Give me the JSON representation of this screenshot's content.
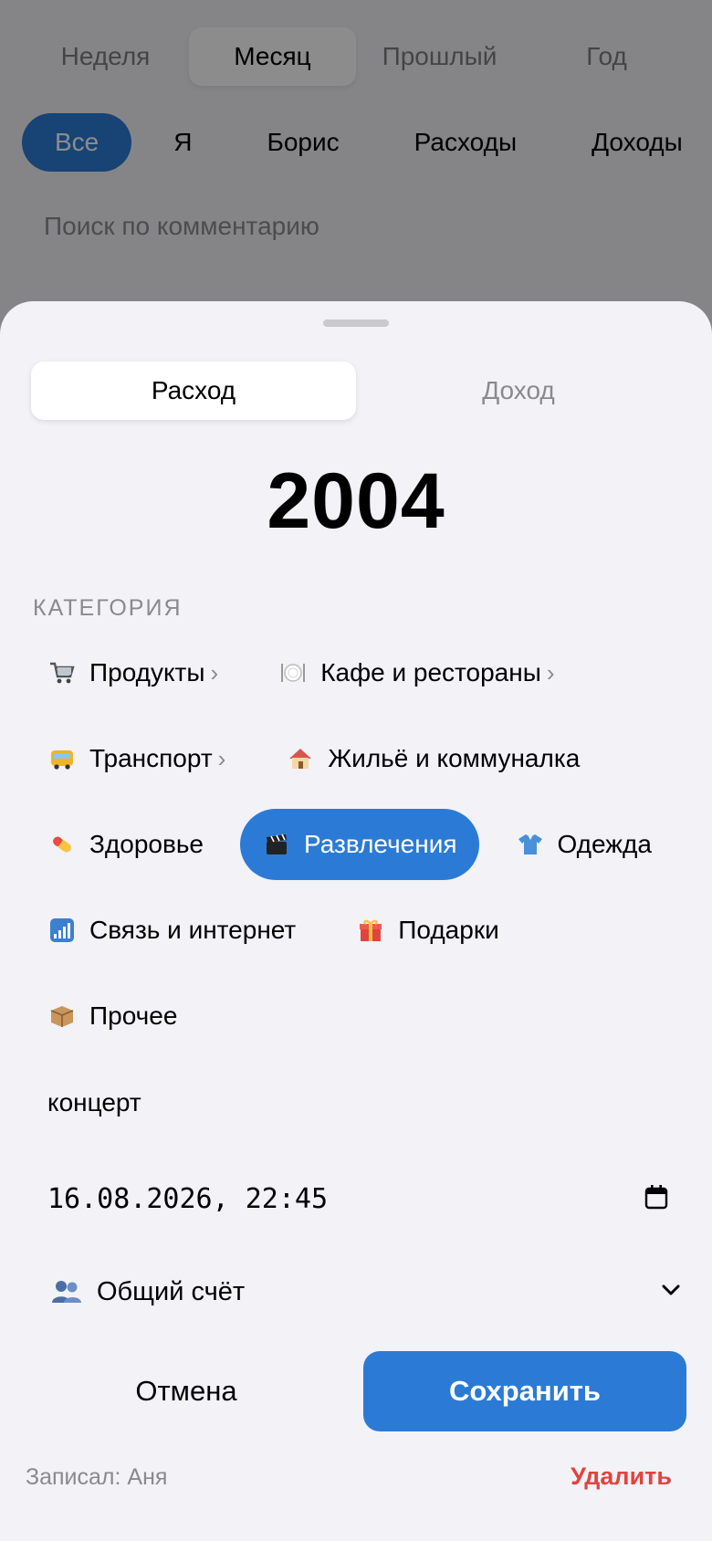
{
  "colors": {
    "accent": "#2b7bd6",
    "danger": "#e0443e",
    "sheet_bg": "#f2f2f7",
    "secondary_text": "#8a8a8e"
  },
  "background": {
    "period_tabs": [
      {
        "label": "Неделя",
        "active": false
      },
      {
        "label": "Месяц",
        "active": true
      },
      {
        "label": "Прошлый",
        "active": false
      },
      {
        "label": "Год",
        "active": false
      }
    ],
    "filters": [
      {
        "label": "Все",
        "active": true
      },
      {
        "label": "Я",
        "active": false
      },
      {
        "label": "Борис",
        "active": false
      },
      {
        "label": "Расходы",
        "active": false
      },
      {
        "label": "Доходы",
        "active": false
      }
    ],
    "search_placeholder": "Поиск по комментарию"
  },
  "sheet": {
    "type_toggle": {
      "expense": "Расход",
      "income": "Доход",
      "selected": "expense"
    },
    "amount": "2004",
    "category_label": "Категория",
    "categories": [
      {
        "icon": "cart-icon",
        "label": "Продукты",
        "has_sub": true,
        "active": false
      },
      {
        "icon": "plate-icon",
        "label": "Кафе и рестораны",
        "has_sub": true,
        "active": false
      },
      {
        "icon": "bus-icon",
        "label": "Транспорт",
        "has_sub": true,
        "active": false
      },
      {
        "icon": "house-icon",
        "label": "Жильё и коммуналка",
        "has_sub": false,
        "active": false
      },
      {
        "icon": "pill-icon",
        "label": "Здоровье",
        "has_sub": false,
        "active": false
      },
      {
        "icon": "clapper-icon",
        "label": "Развлечения",
        "has_sub": false,
        "active": true
      },
      {
        "icon": "shirt-icon",
        "label": "Одежда",
        "has_sub": false,
        "active": false
      },
      {
        "icon": "signal-icon",
        "label": "Связь и интернет",
        "has_sub": false,
        "active": false
      },
      {
        "icon": "gift-icon",
        "label": "Подарки",
        "has_sub": false,
        "active": false
      },
      {
        "icon": "box-icon",
        "label": "Прочее",
        "has_sub": false,
        "active": false
      }
    ],
    "sub_chevron": "›",
    "comment": "концерт",
    "datetime": "16.08.2026, 22:45",
    "account": {
      "icon": "people-icon",
      "label": "Общий счёт"
    },
    "cancel_label": "Отмена",
    "save_label": "Сохранить",
    "author": "Записал: Аня",
    "delete_label": "Удалить"
  }
}
